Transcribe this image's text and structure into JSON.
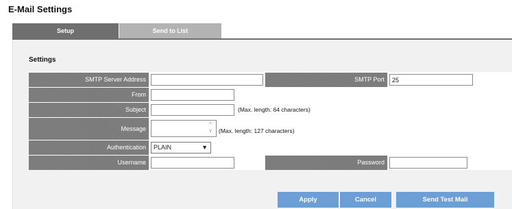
{
  "page": {
    "title": "E-Mail Settings"
  },
  "tabs": [
    {
      "label": "Setup",
      "active": true
    },
    {
      "label": "Send to List",
      "active": false
    }
  ],
  "settings": {
    "section_title": "Settings",
    "smtp_server_address": {
      "label": "SMTP Server Address",
      "value": ""
    },
    "smtp_port": {
      "label": "SMTP Port",
      "value": "25"
    },
    "from": {
      "label": "From",
      "value": ""
    },
    "subject": {
      "label": "Subject",
      "value": "",
      "hint": "(Max. length: 64 characters)"
    },
    "message": {
      "label": "Message",
      "value": "",
      "hint": "(Max. length: 127 characters)"
    },
    "authentication": {
      "label": "Authentication",
      "selected": "PLAIN"
    },
    "username": {
      "label": "Username",
      "value": ""
    },
    "password": {
      "label": "Password",
      "value": ""
    }
  },
  "buttons": {
    "apply": "Apply",
    "cancel": "Cancel",
    "send_test": "Send Test Mail"
  },
  "colors": {
    "tab_active": "#6f6f6f",
    "tab_inactive": "#b3b3b3",
    "label_cell": "#7a7a7a",
    "button": "#6e9ed6"
  }
}
